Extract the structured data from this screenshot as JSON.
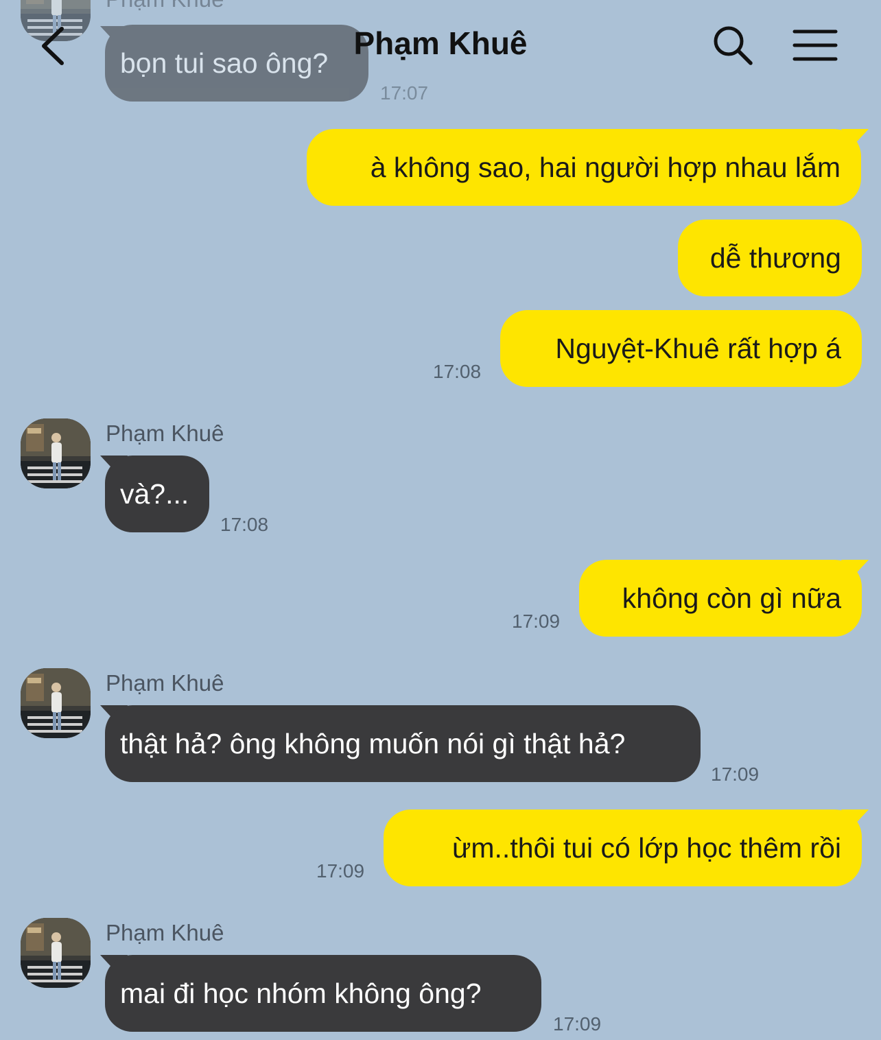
{
  "header": {
    "title": "Phạm Khuê",
    "back_icon": "chevron-left-icon",
    "search_icon": "search-icon",
    "menu_icon": "hamburger-menu-icon"
  },
  "colors": {
    "background": "#abc1d6",
    "outgoing_bubble": "#fee500",
    "incoming_bubble": "#3a3a3c"
  },
  "messages": {
    "m0": {
      "sender": "Phạm Khuê",
      "text": "bọn tui sao ông?",
      "time": "17:07"
    },
    "m1": {
      "text": "à không sao, hai người hợp nhau lắm"
    },
    "m2": {
      "text": "dễ thương"
    },
    "m3": {
      "text": "Nguyệt-Khuê rất hợp á",
      "time": "17:08"
    },
    "m4": {
      "sender": "Phạm Khuê",
      "text": "và?...",
      "time": "17:08"
    },
    "m5": {
      "text": "không còn gì nữa",
      "time": "17:09"
    },
    "m6": {
      "sender": "Phạm Khuê",
      "text": "thật hả? ông không muốn nói gì thật hả?",
      "time": "17:09"
    },
    "m7": {
      "text": "ừm..thôi tui có lớp học thêm rồi",
      "time": "17:09"
    },
    "m8": {
      "sender": "Phạm Khuê",
      "text": "mai đi học nhóm không ông?",
      "time": "17:09"
    }
  }
}
